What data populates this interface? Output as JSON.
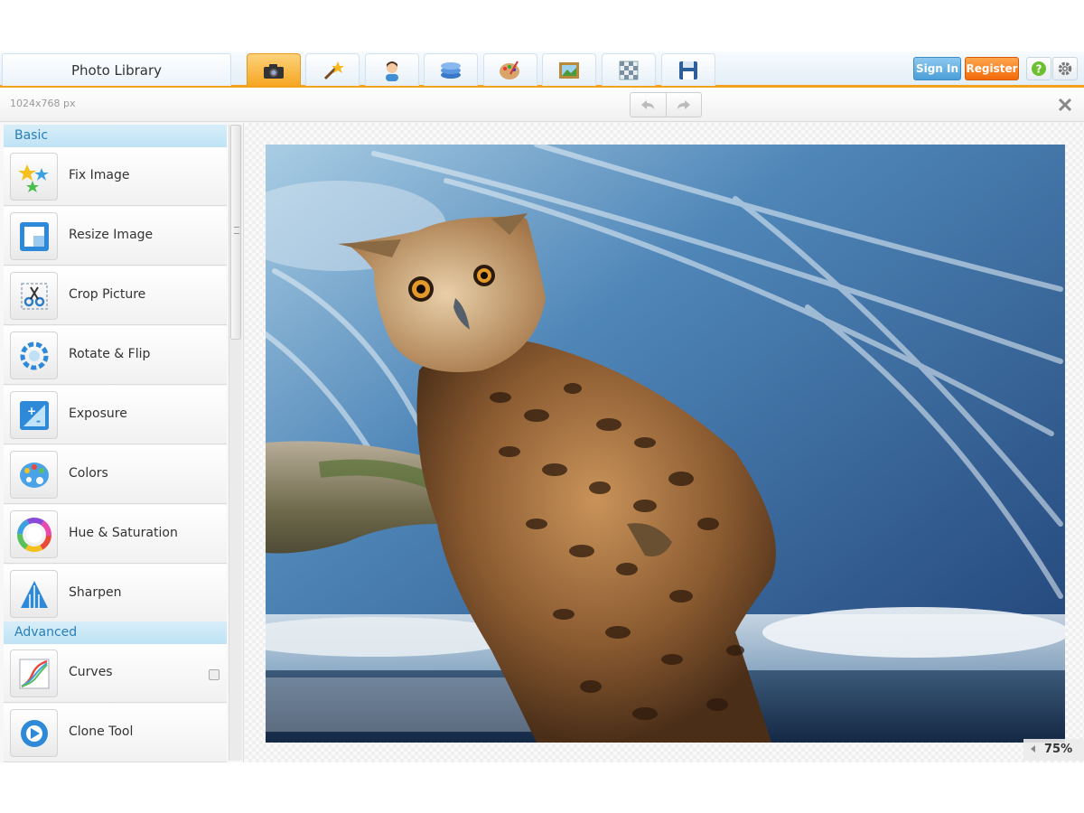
{
  "topbar": {
    "library_tab": "Photo Library",
    "tools": [
      {
        "icon": "camera-icon",
        "active": true
      },
      {
        "icon": "magic-wand-icon",
        "active": false
      },
      {
        "icon": "person-icon",
        "active": false
      },
      {
        "icon": "layers-icon",
        "active": false
      },
      {
        "icon": "palette-icon",
        "active": false
      },
      {
        "icon": "frame-icon",
        "active": false
      },
      {
        "icon": "texture-icon",
        "active": false
      },
      {
        "icon": "save-icon",
        "active": false
      }
    ],
    "signin_label": "Sign In",
    "register_label": "Register",
    "help_icon": "help-icon",
    "settings_icon": "gear-icon"
  },
  "infobar": {
    "dimensions": "1024x768 px",
    "undo_icon": "undo-icon",
    "redo_icon": "redo-icon",
    "close_icon": "close-icon"
  },
  "sidebar": {
    "basic_label": "Basic",
    "advanced_label": "Advanced",
    "items": [
      {
        "label": "Fix Image",
        "icon": "stars-icon"
      },
      {
        "label": "Resize Image",
        "icon": "resize-icon"
      },
      {
        "label": "Crop Picture",
        "icon": "scissors-icon"
      },
      {
        "label": "Rotate & Flip",
        "icon": "rotate-icon"
      },
      {
        "label": "Exposure",
        "icon": "exposure-icon"
      },
      {
        "label": "Colors",
        "icon": "palette-icon"
      },
      {
        "label": "Hue & Saturation",
        "icon": "color-wheel-icon"
      },
      {
        "label": "Sharpen",
        "icon": "sharpen-icon"
      }
    ],
    "advanced_items": [
      {
        "label": "Curves",
        "icon": "curves-icon"
      },
      {
        "label": "Clone Tool",
        "icon": "clone-icon"
      }
    ]
  },
  "canvas": {
    "zoom": "75%"
  },
  "colors": {
    "accent_orange": "#f4a21e",
    "section_blue": "#2a7fb6",
    "signin_blue": "#4a9fd8",
    "register_orange": "#f26a0a"
  }
}
